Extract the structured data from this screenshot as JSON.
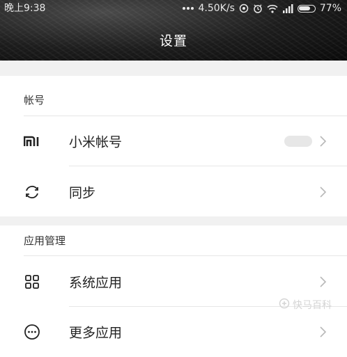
{
  "status_bar": {
    "time": "晚上9:38",
    "speed": "4.50K/s",
    "battery": "77%",
    "battery_level": 0.77
  },
  "header": {
    "title": "设置"
  },
  "sections": [
    {
      "label": "帐号",
      "items": [
        {
          "label": "小米帐号",
          "icon": "mi-logo-icon"
        },
        {
          "label": "同步",
          "icon": "sync-icon"
        }
      ]
    },
    {
      "label": "应用管理",
      "items": [
        {
          "label": "系统应用",
          "icon": "grid-apps-icon"
        },
        {
          "label": "更多应用",
          "icon": "more-dots-icon"
        }
      ]
    }
  ],
  "watermark": "快马百科",
  "colors": {
    "header_bg": "#1a1a1a",
    "section_gap": "#f1f1f1",
    "chevron": "#b8b8b8"
  }
}
